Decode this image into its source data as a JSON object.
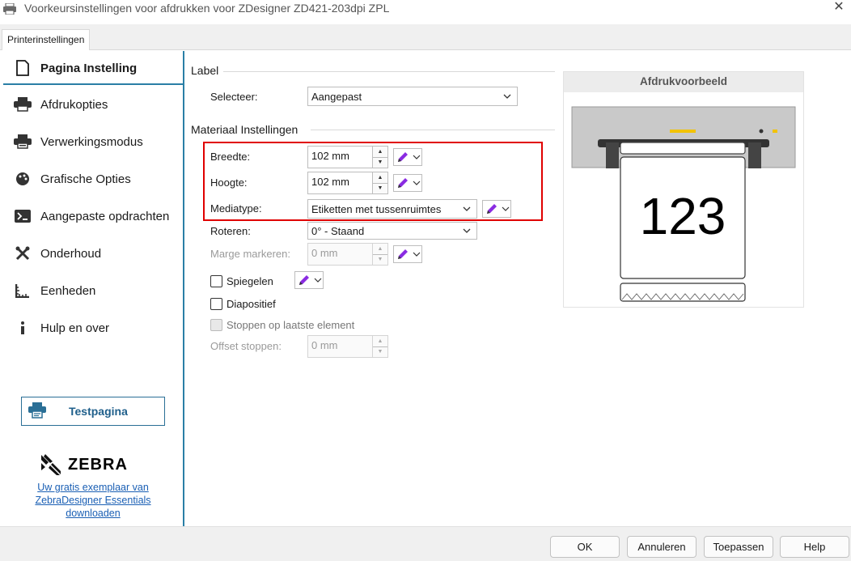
{
  "window": {
    "title": "Voorkeursinstellingen voor afdrukken voor ZDesigner ZD421-203dpi ZPL",
    "close_glyph": "✕"
  },
  "tabs": [
    {
      "label": "Printerinstellingen",
      "active": true
    }
  ],
  "sidebar": {
    "items": [
      {
        "label": "Pagina Instelling",
        "icon": "page-setup-icon",
        "active": true
      },
      {
        "label": "Afdrukopties",
        "icon": "printer-icon"
      },
      {
        "label": "Verwerkingsmodus",
        "icon": "printer-mode-icon"
      },
      {
        "label": "Grafische Opties",
        "icon": "palette-icon"
      },
      {
        "label": "Aangepaste opdrachten",
        "icon": "terminal-icon"
      },
      {
        "label": "Onderhoud",
        "icon": "tools-icon"
      },
      {
        "label": "Eenheden",
        "icon": "ruler-icon"
      },
      {
        "label": "Hulp en over",
        "icon": "info-icon"
      }
    ],
    "testpage_label": "Testpagina",
    "brand": "ZEBRA",
    "promo_link": "Uw gratis exemplaar van ZebraDesigner Essentials downloaden"
  },
  "label_section": {
    "heading": "Label",
    "select_label": "Selecteer:",
    "select_value": "Aangepast"
  },
  "material_section": {
    "heading": "Materiaal Instellingen",
    "width_label": "Breedte:",
    "width_value": "102 mm",
    "height_label": "Hoogte:",
    "height_value": "102 mm",
    "mediatype_label": "Mediatype:",
    "mediatype_value": "Etiketten met tussenruimtes",
    "rotate_label": "Roteren:",
    "rotate_value": "0° - Staand",
    "margin_label": "Marge markeren:",
    "margin_value": "0 mm",
    "mirror_label": "Spiegelen",
    "mirror_checked": false,
    "negative_label": "Diapositief",
    "negative_checked": false,
    "stop_last_label": "Stoppen op laatste element",
    "stop_last_enabled": false,
    "offset_label": "Offset stoppen:",
    "offset_value": "0 mm"
  },
  "preview": {
    "heading": "Afdrukvoorbeeld",
    "sample_text": "123",
    "printer_color": "#c9c9c9",
    "indicator_color": "#f2c200"
  },
  "footer": {
    "ok": "OK",
    "cancel": "Annuleren",
    "apply": "Toepassen",
    "help": "Help"
  },
  "colors": {
    "accent": "#2a7fa6",
    "highlight_box": "#e00000",
    "pen_color": "#8a2be2"
  }
}
